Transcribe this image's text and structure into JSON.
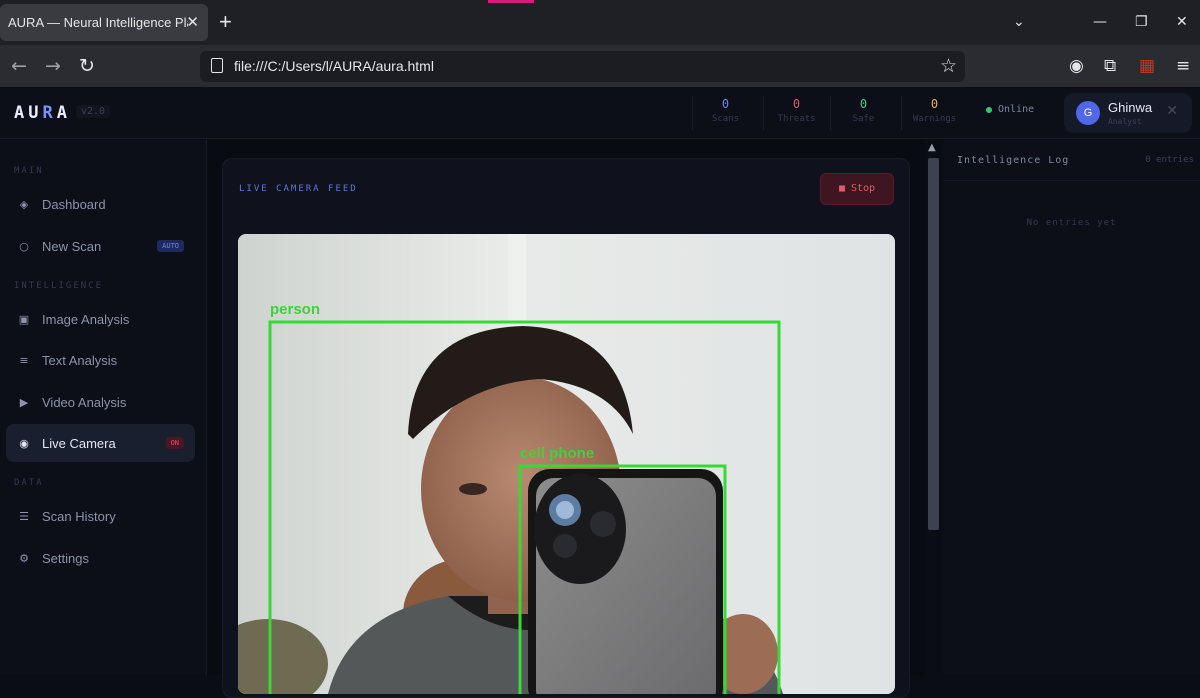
{
  "browser": {
    "tab_title": "AURA — Neural Intelligence Platform",
    "tab_close": "✕",
    "new_tab": "+",
    "url": "file:///C:/Users/l/AURA/aura.html"
  },
  "header": {
    "logo_prefix": "AU",
    "logo_highlight": "R",
    "logo_suffix": "A",
    "version": "v2.0",
    "stats": [
      {
        "value": "0",
        "label": "Scans",
        "color": "#6f86f0"
      },
      {
        "value": "0",
        "label": "Threats",
        "color": "#e4526a"
      },
      {
        "value": "0",
        "label": "Safe",
        "color": "#3ecf8e"
      },
      {
        "value": "0",
        "label": "Warnings",
        "color": "#e8b44a"
      }
    ],
    "status": "Online",
    "user": {
      "initial": "G",
      "name": "Ghinwa",
      "role": "Analyst"
    }
  },
  "sidebar": {
    "sections": [
      {
        "label": "MAIN"
      },
      {
        "label": "INTELLIGENCE"
      },
      {
        "label": "DATA"
      }
    ],
    "items": [
      {
        "label": "Dashboard",
        "icon": "◈"
      },
      {
        "label": "New Scan",
        "icon": "○",
        "badge": "AUTO"
      },
      {
        "label": "Image Analysis",
        "icon": "▣"
      },
      {
        "label": "Text Analysis",
        "icon": "≡"
      },
      {
        "label": "Video Analysis",
        "icon": "▶"
      },
      {
        "label": "Live Camera",
        "icon": "◉",
        "badge": "ON"
      },
      {
        "label": "Scan History",
        "icon": "☰"
      },
      {
        "label": "Settings",
        "icon": "⚙"
      }
    ]
  },
  "main": {
    "card_title": "LIVE CAMERA FEED",
    "stop_label": "■ Stop",
    "detections": [
      {
        "label": "person"
      },
      {
        "label": "cell phone"
      }
    ]
  },
  "log": {
    "title": "Intelligence Log",
    "count": "0 entries",
    "empty": "No entries yet"
  }
}
